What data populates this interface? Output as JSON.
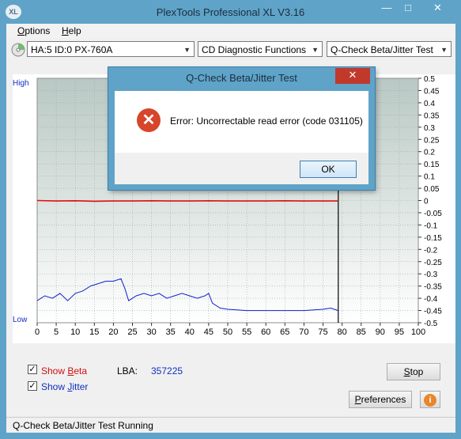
{
  "window": {
    "title": "PlexTools Professional XL V3.16",
    "icon_label": "XL",
    "minimize": "—",
    "maximize": "□",
    "close": "✕"
  },
  "menu": {
    "items": [
      {
        "label": "Options",
        "mnemonic": "O",
        "rest": "ptions"
      },
      {
        "label": "Help",
        "mnemonic": "H",
        "rest": "elp"
      }
    ]
  },
  "toolbar": {
    "drive": "HA:5 ID:0  PX-760A",
    "function": "CD Diagnostic Functions",
    "test": "Q-Check Beta/Jitter Test"
  },
  "chart_data": {
    "type": "line",
    "left_axis": {
      "top_label": "High",
      "bottom_label": "Low"
    },
    "xlim": [
      0,
      100
    ],
    "x_ticks": [
      "0",
      "5",
      "10",
      "15",
      "20",
      "25",
      "30",
      "35",
      "40",
      "45",
      "50",
      "55",
      "60",
      "65",
      "70",
      "75",
      "80",
      "85",
      "90",
      "95",
      "100"
    ],
    "ylim": [
      -0.5,
      0.5
    ],
    "y_ticks": [
      "0.5",
      "0.45",
      "0.4",
      "0.35",
      "0.3",
      "0.25",
      "0.2",
      "0.15",
      "0.1",
      "0.05",
      "0",
      "-0.05",
      "-0.1",
      "-0.15",
      "-0.2",
      "-0.25",
      "-0.3",
      "-0.35",
      "-0.4",
      "-0.45",
      "-0.5"
    ],
    "grid": true,
    "cursor_x": 79,
    "series": [
      {
        "color": "#e01010",
        "x": [
          0,
          5,
          10,
          15,
          20,
          25,
          30,
          35,
          40,
          45,
          50,
          55,
          60,
          65,
          70,
          75,
          79
        ],
        "y": [
          0.0,
          -0.002,
          -0.001,
          -0.003,
          -0.002,
          -0.002,
          -0.001,
          -0.002,
          -0.002,
          -0.001,
          -0.002,
          -0.002,
          -0.002,
          -0.001,
          -0.002,
          -0.002,
          -0.002
        ]
      },
      {
        "color": "#1020d0",
        "x": [
          0,
          2,
          4,
          6,
          8,
          10,
          12,
          14,
          16,
          18,
          20,
          22,
          23,
          24,
          26,
          28,
          30,
          32,
          34,
          36,
          38,
          40,
          42,
          44,
          45,
          46,
          48,
          50,
          55,
          60,
          65,
          70,
          75,
          77,
          79
        ],
        "y": [
          -0.41,
          -0.39,
          -0.4,
          -0.38,
          -0.41,
          -0.38,
          -0.37,
          -0.35,
          -0.34,
          -0.33,
          -0.33,
          -0.32,
          -0.36,
          -0.41,
          -0.39,
          -0.38,
          -0.39,
          -0.38,
          -0.4,
          -0.39,
          -0.38,
          -0.39,
          -0.4,
          -0.39,
          -0.38,
          -0.42,
          -0.44,
          -0.445,
          -0.45,
          -0.45,
          -0.45,
          -0.45,
          -0.445,
          -0.44,
          -0.45
        ]
      }
    ]
  },
  "bottom": {
    "show_beta": {
      "label": "Show Beta",
      "pre": "Show ",
      "mnemonic": "B",
      "rest": "eta",
      "checked": true,
      "color": "#d01010"
    },
    "show_jitter": {
      "label": "Show Jitter",
      "pre": "Show ",
      "mnemonic": "J",
      "rest": "itter",
      "checked": true,
      "color": "#1030c0"
    },
    "lba_label": "LBA:",
    "lba_value": "357225",
    "stop_label": "Stop",
    "stop_mnemonic": "S",
    "stop_rest": "top",
    "preferences_label": "Preferences",
    "pref_mnemonic": "P",
    "pref_rest": "references",
    "info_icon": "i"
  },
  "status": {
    "text": "Q-Check Beta/Jitter Test Running"
  },
  "dialog": {
    "title": "Q-Check Beta/Jitter Test",
    "close": "✕",
    "icon": "✕",
    "message": "Error: Uncorrectable read error (code 031105)",
    "ok_label": "OK"
  }
}
